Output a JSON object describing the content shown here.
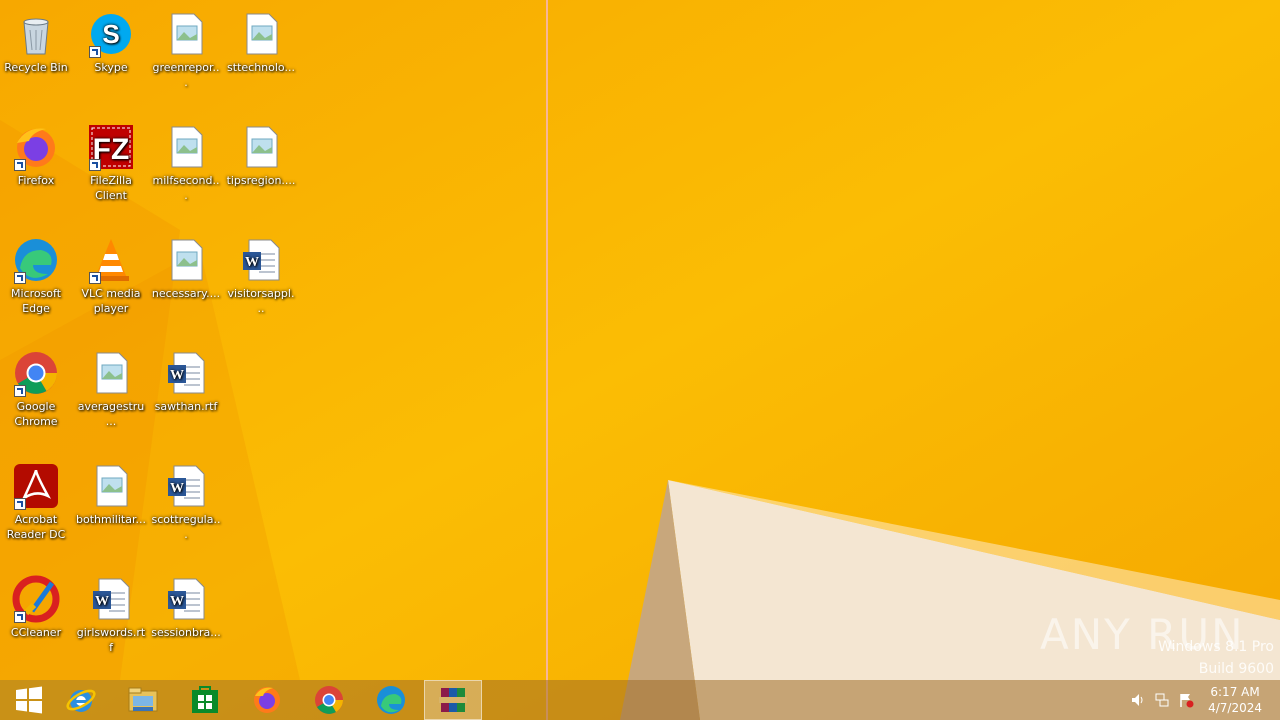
{
  "desktop": {
    "icons": [
      {
        "label": "Recycle Bin",
        "icon": "recycle-bin-icon"
      },
      {
        "label": "Skype",
        "icon": "skype-icon"
      },
      {
        "label": "greenrepor...",
        "icon": "image-file-icon"
      },
      {
        "label": "sttechnolo...",
        "icon": "image-file-icon"
      },
      {
        "label": "Firefox",
        "icon": "firefox-icon"
      },
      {
        "label": "FileZilla Client",
        "icon": "filezilla-icon"
      },
      {
        "label": "milfsecond...",
        "icon": "image-file-icon"
      },
      {
        "label": "tipsregion....",
        "icon": "image-file-icon"
      },
      {
        "label": "Microsoft Edge",
        "icon": "edge-icon"
      },
      {
        "label": "VLC media player",
        "icon": "vlc-icon"
      },
      {
        "label": "necessary....",
        "icon": "image-file-icon"
      },
      {
        "label": "visitorsappl...",
        "icon": "word-doc-icon"
      },
      {
        "label": "Google Chrome",
        "icon": "chrome-icon"
      },
      {
        "label": "averagestru...",
        "icon": "image-file-icon"
      },
      {
        "label": "sawthan.rtf",
        "icon": "word-doc-icon"
      },
      {
        "label": "Acrobat Reader DC",
        "icon": "acrobat-icon"
      },
      {
        "label": "bothmilitar...",
        "icon": "image-file-icon"
      },
      {
        "label": "scottregula...",
        "icon": "word-doc-icon"
      },
      {
        "label": "CCleaner",
        "icon": "ccleaner-icon"
      },
      {
        "label": "girlswords.rtf",
        "icon": "word-doc-icon"
      },
      {
        "label": "sessionbra...",
        "icon": "word-doc-icon"
      }
    ]
  },
  "watermark": "ANY RUN",
  "os_version": {
    "line1": "Windows 8.1 Pro",
    "line2": "Build 9600"
  },
  "taskbar": {
    "buttons": [
      {
        "name": "start-button",
        "icon": "windows-logo-icon"
      },
      {
        "name": "internet-explorer-button",
        "icon": "internet-explorer-icon"
      },
      {
        "name": "file-explorer-button",
        "icon": "file-explorer-icon"
      },
      {
        "name": "store-button",
        "icon": "store-icon"
      },
      {
        "name": "firefox-button",
        "icon": "firefox-icon"
      },
      {
        "name": "chrome-button",
        "icon": "chrome-icon"
      },
      {
        "name": "edge-button",
        "icon": "edge-icon"
      },
      {
        "name": "winrar-button",
        "icon": "winrar-icon",
        "active": true
      }
    ],
    "tray": {
      "icons": [
        "speaker-icon",
        "network-icon",
        "action-center-flag-icon"
      ]
    },
    "clock": {
      "time": "6:17 AM",
      "date": "4/7/2024"
    }
  },
  "colors": {
    "wallpaper": "#f7a800",
    "taskbar": "#a06e28"
  }
}
